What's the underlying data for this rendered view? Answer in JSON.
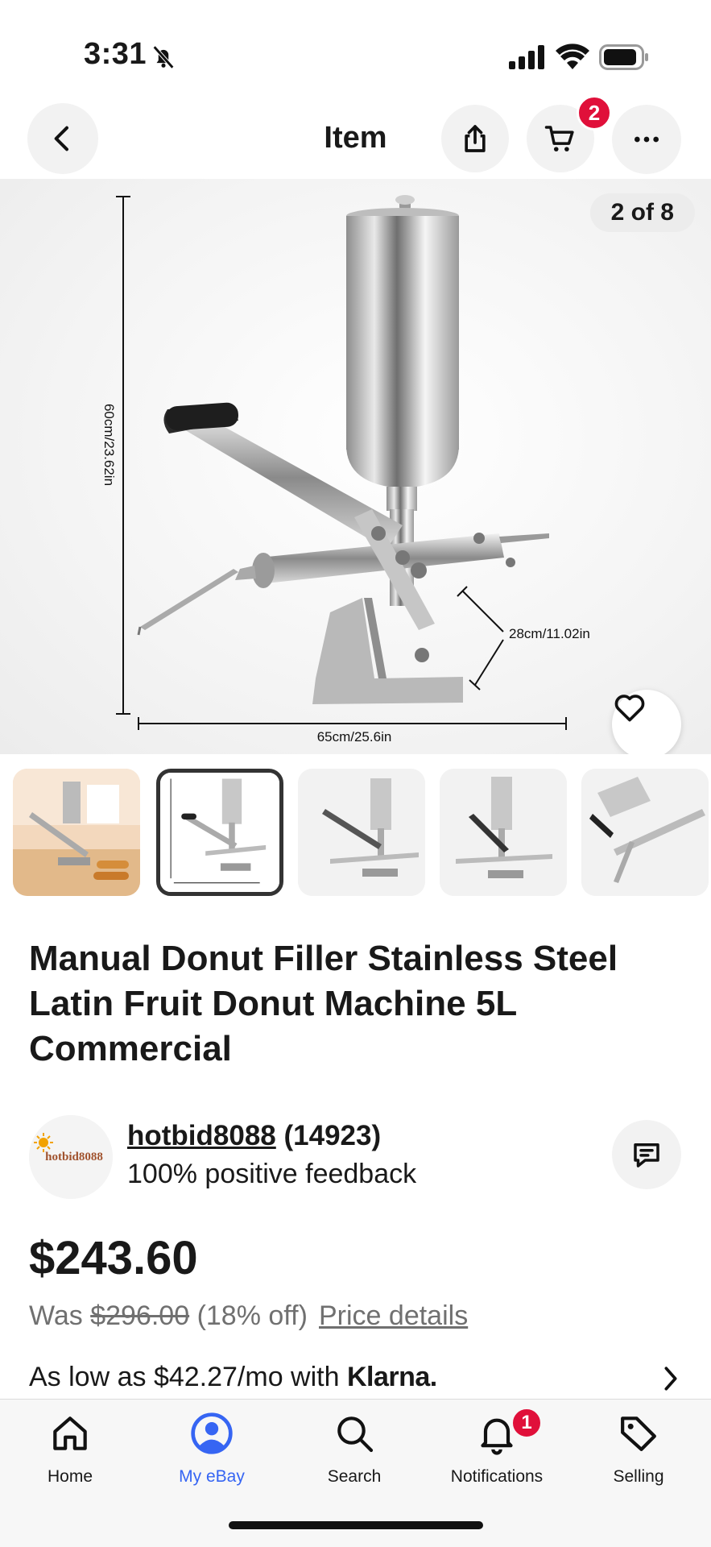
{
  "status_bar": {
    "time": "3:31",
    "icons": [
      "bell-off-icon",
      "signal-icon",
      "wifi-icon",
      "battery-icon"
    ]
  },
  "nav": {
    "title": "Item",
    "cart_count": "2",
    "icons": [
      "back-icon",
      "share-icon",
      "cart-icon",
      "more-icon"
    ]
  },
  "gallery": {
    "counter": "2 of 8",
    "dimensions": {
      "height": "60cm/23.62in",
      "width": "65cm/25.6in",
      "depth": "28cm/11.02in"
    },
    "thumbnail_count": 5,
    "selected_index": 1
  },
  "item": {
    "title": "Manual Donut Filler Stainless Steel Latin Fruit Donut Machine 5L Commercial"
  },
  "seller": {
    "logo_text": "hotbid8088",
    "name": "hotbid8088",
    "score": "(14923)",
    "feedback": "100% positive feedback"
  },
  "pricing": {
    "price": "$243.60",
    "was_label": "Was",
    "was_price": "$296.00",
    "discount": "(18% off)",
    "price_details": "Price details",
    "klarna_text": "As low as $42.27/mo with",
    "klarna_brand": "Klarna."
  },
  "tab_bar": {
    "tabs": [
      {
        "label": "Home",
        "icon": "home-icon"
      },
      {
        "label": "My eBay",
        "icon": "user-icon"
      },
      {
        "label": "Search",
        "icon": "search-icon"
      },
      {
        "label": "Notifications",
        "icon": "bell-icon"
      },
      {
        "label": "Selling",
        "icon": "tag-icon"
      }
    ],
    "active": "My eBay",
    "notifications_badge": "1"
  },
  "colors": {
    "accent": "#3665f3",
    "badge": "#e0103a",
    "text": "#191919",
    "muted": "#707070"
  }
}
